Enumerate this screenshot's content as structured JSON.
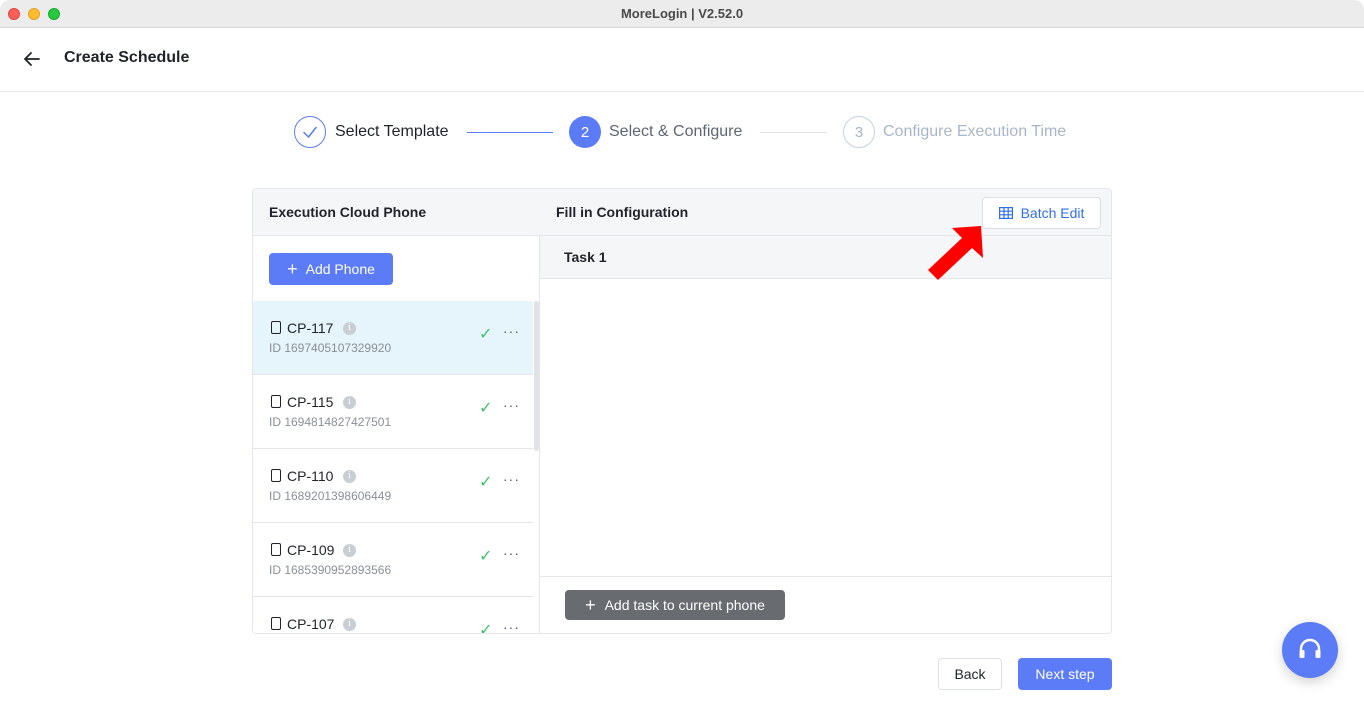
{
  "window": {
    "title": "MoreLogin | V2.52.0"
  },
  "header": {
    "title": "Create Schedule",
    "back_icon": "arrow-left-icon"
  },
  "steps": [
    {
      "number": "1",
      "label": "Select Template",
      "status": "done"
    },
    {
      "number": "2",
      "label": "Select & Configure",
      "status": "active"
    },
    {
      "number": "3",
      "label": "Configure Execution Time",
      "status": "pending"
    }
  ],
  "left_panel": {
    "title": "Execution Cloud Phone",
    "add_button": "Add Phone",
    "phones": [
      {
        "name": "CP-117",
        "id": "ID 1697405107329920"
      },
      {
        "name": "CP-115",
        "id": "ID 1694814827427501"
      },
      {
        "name": "CP-110",
        "id": "ID 1689201398606449"
      },
      {
        "name": "CP-109",
        "id": "ID 1685390952893566"
      },
      {
        "name": "CP-107",
        "id": ""
      }
    ]
  },
  "right_panel": {
    "title": "Fill in Configuration",
    "batch_edit": "Batch Edit",
    "task_label": "Task 1",
    "add_task": "Add task to current phone"
  },
  "footer": {
    "back": "Back",
    "next": "Next step"
  },
  "colors": {
    "primary": "#5b7cf6",
    "success": "#3ec26b",
    "annotation": "#ff0000"
  }
}
